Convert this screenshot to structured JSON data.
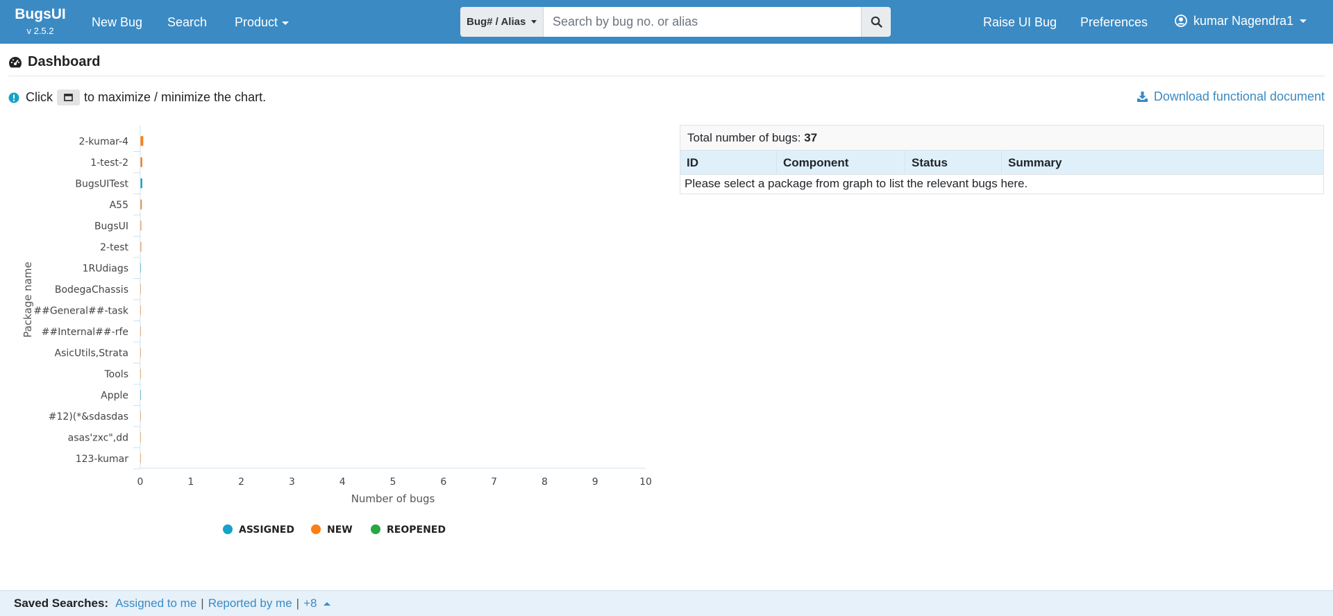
{
  "navbar": {
    "brand_name": "BugsUI",
    "brand_version": "v 2.5.2",
    "new_bug_label": "New Bug",
    "search_label": "Search",
    "product_label": "Product",
    "search_type": "Bug# / Alias",
    "search_placeholder": "Search by bug no. or alias",
    "raise_ui_bug_label": "Raise UI Bug",
    "preferences_label": "Preferences",
    "user_name": "kumar Nagendra1"
  },
  "page": {
    "title": "Dashboard",
    "hint_prefix": "Click",
    "hint_suffix": "to maximize / minimize the chart.",
    "download_label": "Download functional document"
  },
  "chart_data": {
    "type": "bar",
    "orientation": "horizontal",
    "stacked": true,
    "categories": [
      "2-kumar-4",
      "1-test-2",
      "BugsUITest",
      "A55",
      "BugsUI",
      "2-test",
      "1RUdiags",
      "BodegaChassis",
      "##General##-task",
      "##Internal##-rfe",
      "AsicUtils,Strata",
      "Tools",
      "Apple",
      "#12)(*&sdasdas",
      "asas'zxc\",dd",
      "123-kumar"
    ],
    "series": [
      {
        "name": "ASSIGNED",
        "color": "#17a2c8",
        "values": [
          0,
          0,
          0.04,
          0,
          0,
          0,
          0.01,
          0,
          0,
          0,
          0,
          0,
          0.01,
          0,
          0,
          0
        ]
      },
      {
        "name": "NEW",
        "color": "#fd7e14",
        "values": [
          0.06,
          0.04,
          0,
          0.03,
          0.02,
          0.02,
          0,
          0.01,
          0.01,
          0.01,
          0.01,
          0.01,
          0,
          0.01,
          0.01,
          0.01
        ]
      },
      {
        "name": "REOPENED",
        "color": "#28a745",
        "values": [
          0,
          0,
          0,
          0,
          0,
          0,
          0,
          0,
          0,
          0,
          0,
          0,
          0,
          0,
          0,
          0
        ]
      }
    ],
    "xlabel": "Number of bugs",
    "ylabel": "Package name",
    "xlim": [
      0,
      10
    ],
    "xticks": [
      0,
      1,
      2,
      3,
      4,
      5,
      6,
      7,
      8,
      9,
      10
    ],
    "legend_position": "bottom"
  },
  "bugs": {
    "total_label": "Total number of bugs:",
    "total_count": "37",
    "columns": [
      "ID",
      "Component",
      "Status",
      "Summary"
    ],
    "empty_message": "Please select a package from graph to list the relevant bugs here."
  },
  "footer": {
    "label": "Saved Searches:",
    "assigned_link": "Assigned to me",
    "reported_link": "Reported by me",
    "more_link": "+8",
    "separator": "|"
  },
  "colors": {
    "navbar": "#3b8ac3",
    "link": "#3b8ac3",
    "table_header": "#dff0fb",
    "footer": "#e6f1fa"
  }
}
